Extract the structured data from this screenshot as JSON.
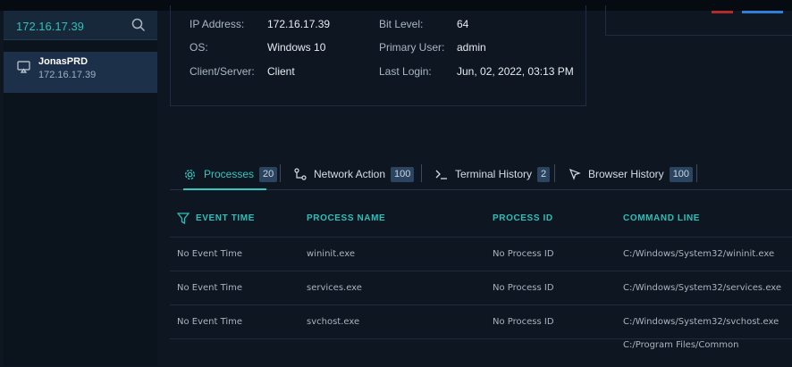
{
  "sidebar": {
    "search_value": "172.16.17.39",
    "device": {
      "name": "JonasPRD",
      "ip": "172.16.17.39"
    }
  },
  "info": {
    "ip_label": "IP Address:",
    "ip_value": "172.16.17.39",
    "os_label": "OS:",
    "os_value": "Windows 10",
    "client_label": "Client/Server:",
    "client_value": "Client",
    "bit_label": "Bit Level:",
    "bit_value": "64",
    "user_label": "Primary User:",
    "user_value": "admin",
    "login_label": "Last Login:",
    "login_value": "Jun, 02, 2022, 03:13 PM"
  },
  "tabs": [
    {
      "label": "Processes",
      "count": "20",
      "icon": "gear-icon",
      "active": true
    },
    {
      "label": "Network Action",
      "count": "100",
      "icon": "network-icon",
      "active": false
    },
    {
      "label": "Terminal History",
      "count": "2",
      "icon": "terminal-icon",
      "active": false
    },
    {
      "label": "Browser History",
      "count": "100",
      "icon": "cursor-icon",
      "active": false
    }
  ],
  "table": {
    "columns": [
      "EVENT TIME",
      "PROCESS NAME",
      "PROCESS ID",
      "COMMAND LINE"
    ],
    "rows": [
      [
        "No Event Time",
        "wininit.exe",
        "No Process ID",
        "C:/Windows/System32/wininit.exe"
      ],
      [
        "No Event Time",
        "services.exe",
        "No Process ID",
        "C:/Windows/System32/services.exe"
      ],
      [
        "No Event Time",
        "svchost.exe",
        "No Process ID",
        "C:/Windows/System32/svchost.exe"
      ],
      [
        "",
        "",
        "",
        "C:/Program Files/Common"
      ]
    ]
  },
  "colors": {
    "accent": "#35c7bf",
    "background": "#0d1621",
    "selected": "#1d3049"
  }
}
